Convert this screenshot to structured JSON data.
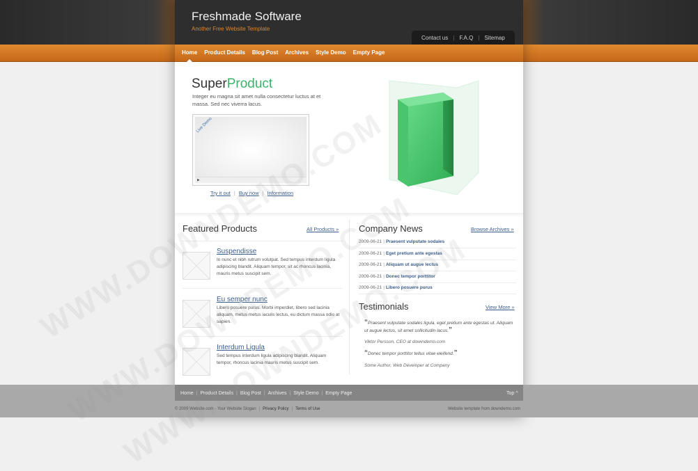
{
  "header": {
    "title": "Freshmade Software",
    "subtitle": "Another Free Website Template",
    "top_links": [
      "Contact us",
      "F.A.Q",
      "Sitemap"
    ]
  },
  "nav": {
    "items": [
      "Home",
      "Product Details",
      "Blog Post",
      "Archives",
      "Style Demo",
      "Empty Page"
    ],
    "active": "Home"
  },
  "hero": {
    "title_part1": "Super",
    "title_part2": "Product",
    "text": "Integer eu magna sit amet nulla consectetur luctus at et massa. Sed nec viverra lacus.",
    "ribbon": "Live Demo",
    "links": [
      "Try it out",
      "Buy now",
      "Information"
    ]
  },
  "featured": {
    "title": "Featured Products",
    "more": "All Products »",
    "products": [
      {
        "title": "Suspendisse",
        "text": "In nunc et nibh rutrum volutpat. Sed tempus interdum ligula adipiscing blandit. Aliquam tempor, sit ac rhoncus lacinia, mauris metus suscipit sem."
      },
      {
        "title": "Eu semper nunc",
        "text": "Libero posuere purus. Morbi imperdiet, libero sed lacinia aliquam, metus metus iaculis lectus, eu dictum massa odio at sapien."
      },
      {
        "title": "Interdum Ligula",
        "text": "Sed tempus interdum ligula adipiscing blandit. Aliquam tempor, rhoncus lacinia mauris metus suscipit sem."
      }
    ]
  },
  "news": {
    "title": "Company News",
    "more": "Browse Archives »",
    "items": [
      {
        "date": "2009-06-21",
        "title": "Praesent vulputate sodales"
      },
      {
        "date": "2009-06-21",
        "title": "Eget pretium ante egestas"
      },
      {
        "date": "2009-06-21",
        "title": "Aliquam ut augue lectus"
      },
      {
        "date": "2009-06-21",
        "title": "Donec tempor porttitor"
      },
      {
        "date": "2009-06-21",
        "title": "Libero posuere purus"
      }
    ]
  },
  "testimonials": {
    "title": "Testimonials",
    "more": "View More »",
    "items": [
      {
        "quote": "Praesent vulputate sodales ligula, eget pretium ante egestas ut. Aliquam ut augue lectus, sit amet sollicitudin lacus.",
        "author": "Viktor Persson, CEO at dowindemo.com"
      },
      {
        "quote": "Donec tempor porttitor tellus vitae eleifend.",
        "author": "Some Author, Web Developer at Company"
      }
    ]
  },
  "footer": {
    "links": [
      "Home",
      "Product Details",
      "Blog Post",
      "Archives",
      "Style Demo",
      "Empty Page"
    ],
    "top": "Top ^",
    "copyright": "© 2009 Website.com - Your Website Slogan",
    "privacy": "Privacy Policy",
    "terms": "Terms of Use",
    "credit": "Website template from downdemo.com"
  },
  "watermark": "WWW.DOWNDEMO.COM"
}
